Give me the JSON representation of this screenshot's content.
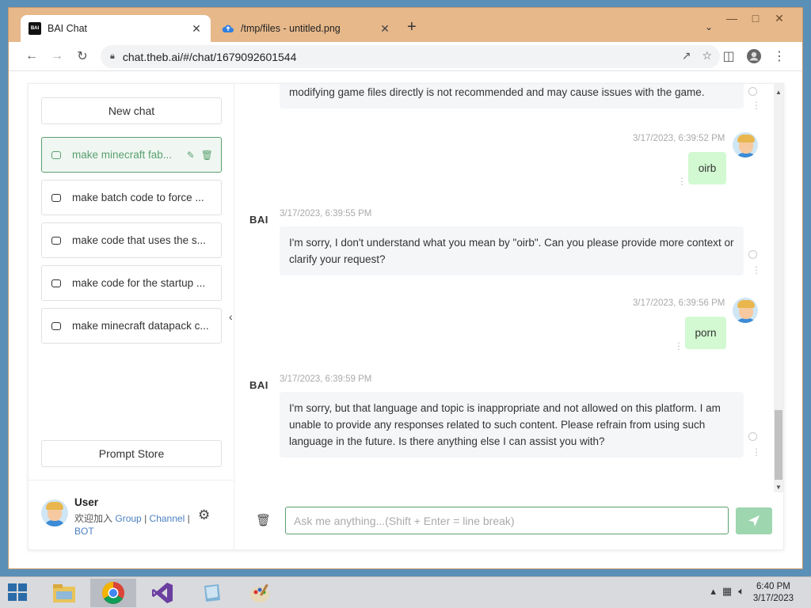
{
  "browser": {
    "tabs": [
      {
        "title": "BAI Chat",
        "favicon": "bai-logo"
      },
      {
        "title": "/tmp/files - untitled.png",
        "favicon": "cloud-icon"
      }
    ],
    "url": "chat.theb.ai/#/chat/1679092601544"
  },
  "sidebar": {
    "new_chat": "New chat",
    "history": [
      {
        "title": "make minecraft fab..."
      },
      {
        "title": "make batch code to force ..."
      },
      {
        "title": "make code that uses the s..."
      },
      {
        "title": "make code for the startup ..."
      },
      {
        "title": "make minecraft datapack c..."
      }
    ],
    "prompt_store": "Prompt Store",
    "user": {
      "name": "User",
      "prefix": "欢迎加入",
      "link_group": "Group",
      "sep": "|",
      "link_channel": "Channel",
      "link_bot": "BOT"
    }
  },
  "chat": {
    "bot_label": "BAI",
    "messages": [
      {
        "role": "bot",
        "text": "modifying game files directly is not recommended and may cause issues with the game."
      },
      {
        "role": "user",
        "time": "3/17/2023, 6:39:52 PM",
        "text": "oirb"
      },
      {
        "role": "bot",
        "time": "3/17/2023, 6:39:55 PM",
        "text": "I'm sorry, I don't understand what you mean by \"oirb\". Can you please provide more context or clarify your request?"
      },
      {
        "role": "user",
        "time": "3/17/2023, 6:39:56 PM",
        "text": "porn"
      },
      {
        "role": "bot",
        "time": "3/17/2023, 6:39:59 PM",
        "text": "I'm sorry, but that language and topic is inappropriate and not allowed on this platform. I am unable to provide any responses related to such content. Please refrain from using such language in the future. Is there anything else I can assist you with?"
      }
    ],
    "input_placeholder": "Ask me anything...(Shift + Enter = line break)"
  },
  "taskbar": {
    "time": "6:40 PM",
    "date": "3/17/2023"
  },
  "colors": {
    "accent": "#5aa06f",
    "user_bubble": "#d2f9d1",
    "bot_bubble": "#f4f6f8",
    "window_frame": "#e6b88a"
  }
}
